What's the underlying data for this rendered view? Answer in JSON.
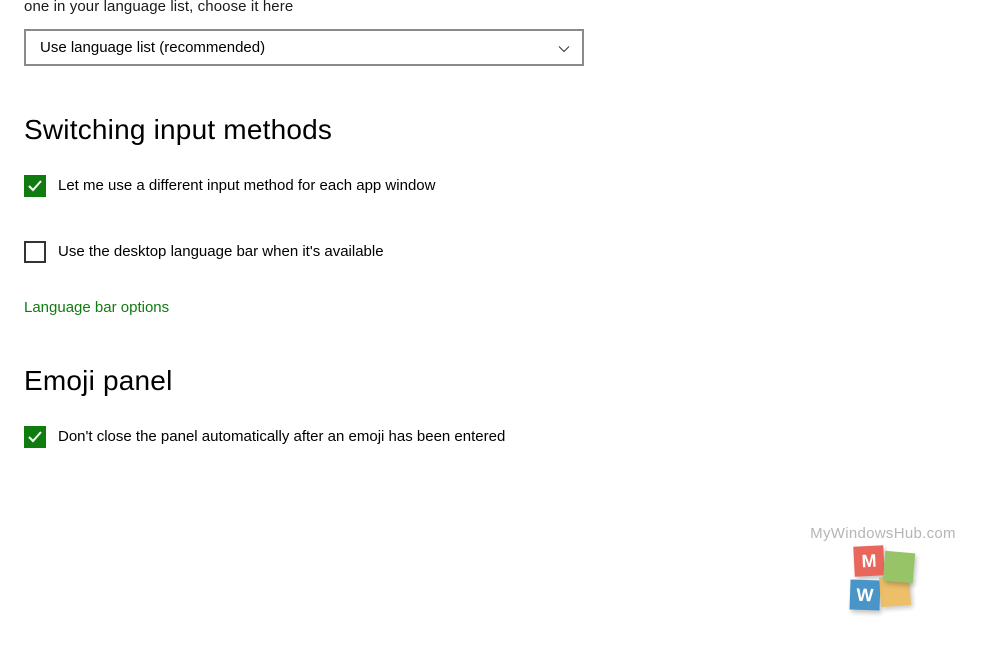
{
  "intro": {
    "partial_text": "one in your language list, choose it here"
  },
  "dropdown": {
    "selected": "Use language list (recommended)"
  },
  "sections": {
    "switching": {
      "heading": "Switching input methods",
      "checkbox1": {
        "checked": true,
        "label": "Let me use a different input method for each app window"
      },
      "checkbox2": {
        "checked": false,
        "label": "Use the desktop language bar when it's available"
      },
      "link": "Language bar options"
    },
    "emoji": {
      "heading": "Emoji panel",
      "checkbox1": {
        "checked": true,
        "label": "Don't close the panel automatically after an emoji has been entered"
      }
    }
  },
  "watermark": {
    "text": "MyWindowsHub.com",
    "letters": {
      "m": "M",
      "y": "",
      "w": "W",
      "h": ""
    }
  }
}
